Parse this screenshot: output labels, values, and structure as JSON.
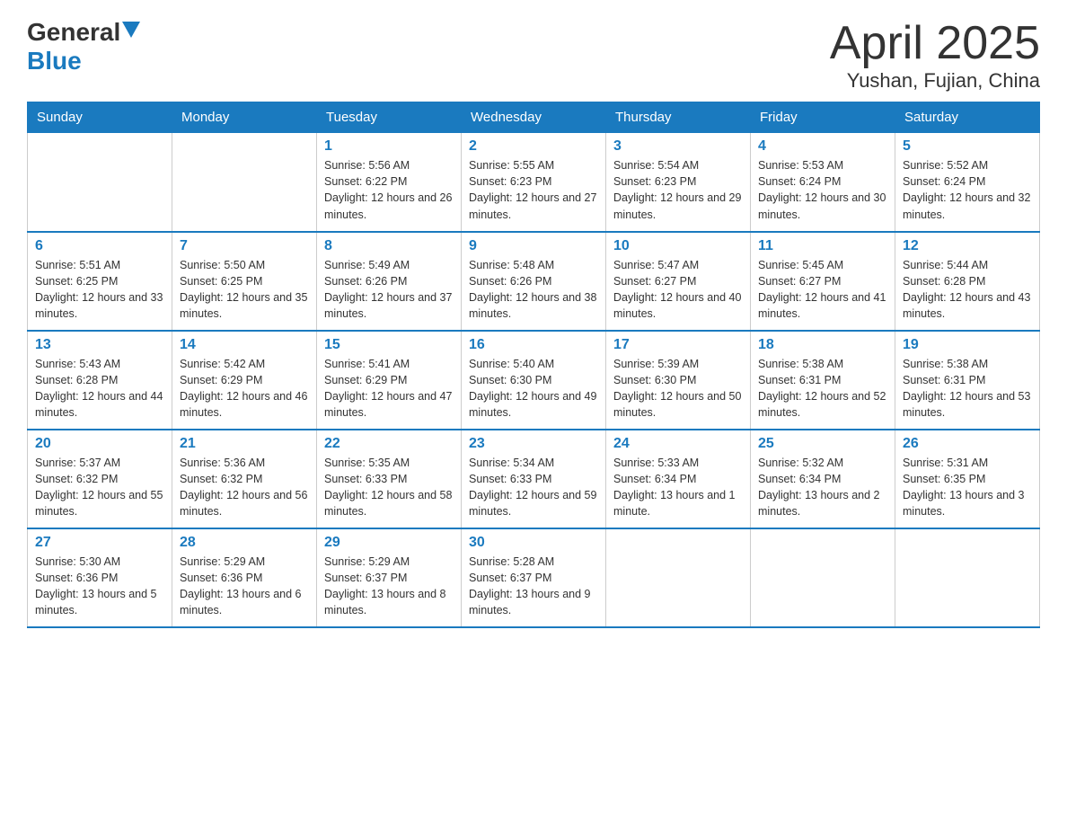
{
  "header": {
    "logo_general": "General",
    "logo_blue": "Blue",
    "month": "April 2025",
    "location": "Yushan, Fujian, China"
  },
  "weekdays": [
    "Sunday",
    "Monday",
    "Tuesday",
    "Wednesday",
    "Thursday",
    "Friday",
    "Saturday"
  ],
  "weeks": [
    [
      null,
      null,
      {
        "day": 1,
        "sunrise": "5:56 AM",
        "sunset": "6:22 PM",
        "daylight": "12 hours and 26 minutes."
      },
      {
        "day": 2,
        "sunrise": "5:55 AM",
        "sunset": "6:23 PM",
        "daylight": "12 hours and 27 minutes."
      },
      {
        "day": 3,
        "sunrise": "5:54 AM",
        "sunset": "6:23 PM",
        "daylight": "12 hours and 29 minutes."
      },
      {
        "day": 4,
        "sunrise": "5:53 AM",
        "sunset": "6:24 PM",
        "daylight": "12 hours and 30 minutes."
      },
      {
        "day": 5,
        "sunrise": "5:52 AM",
        "sunset": "6:24 PM",
        "daylight": "12 hours and 32 minutes."
      }
    ],
    [
      {
        "day": 6,
        "sunrise": "5:51 AM",
        "sunset": "6:25 PM",
        "daylight": "12 hours and 33 minutes."
      },
      {
        "day": 7,
        "sunrise": "5:50 AM",
        "sunset": "6:25 PM",
        "daylight": "12 hours and 35 minutes."
      },
      {
        "day": 8,
        "sunrise": "5:49 AM",
        "sunset": "6:26 PM",
        "daylight": "12 hours and 37 minutes."
      },
      {
        "day": 9,
        "sunrise": "5:48 AM",
        "sunset": "6:26 PM",
        "daylight": "12 hours and 38 minutes."
      },
      {
        "day": 10,
        "sunrise": "5:47 AM",
        "sunset": "6:27 PM",
        "daylight": "12 hours and 40 minutes."
      },
      {
        "day": 11,
        "sunrise": "5:45 AM",
        "sunset": "6:27 PM",
        "daylight": "12 hours and 41 minutes."
      },
      {
        "day": 12,
        "sunrise": "5:44 AM",
        "sunset": "6:28 PM",
        "daylight": "12 hours and 43 minutes."
      }
    ],
    [
      {
        "day": 13,
        "sunrise": "5:43 AM",
        "sunset": "6:28 PM",
        "daylight": "12 hours and 44 minutes."
      },
      {
        "day": 14,
        "sunrise": "5:42 AM",
        "sunset": "6:29 PM",
        "daylight": "12 hours and 46 minutes."
      },
      {
        "day": 15,
        "sunrise": "5:41 AM",
        "sunset": "6:29 PM",
        "daylight": "12 hours and 47 minutes."
      },
      {
        "day": 16,
        "sunrise": "5:40 AM",
        "sunset": "6:30 PM",
        "daylight": "12 hours and 49 minutes."
      },
      {
        "day": 17,
        "sunrise": "5:39 AM",
        "sunset": "6:30 PM",
        "daylight": "12 hours and 50 minutes."
      },
      {
        "day": 18,
        "sunrise": "5:38 AM",
        "sunset": "6:31 PM",
        "daylight": "12 hours and 52 minutes."
      },
      {
        "day": 19,
        "sunrise": "5:38 AM",
        "sunset": "6:31 PM",
        "daylight": "12 hours and 53 minutes."
      }
    ],
    [
      {
        "day": 20,
        "sunrise": "5:37 AM",
        "sunset": "6:32 PM",
        "daylight": "12 hours and 55 minutes."
      },
      {
        "day": 21,
        "sunrise": "5:36 AM",
        "sunset": "6:32 PM",
        "daylight": "12 hours and 56 minutes."
      },
      {
        "day": 22,
        "sunrise": "5:35 AM",
        "sunset": "6:33 PM",
        "daylight": "12 hours and 58 minutes."
      },
      {
        "day": 23,
        "sunrise": "5:34 AM",
        "sunset": "6:33 PM",
        "daylight": "12 hours and 59 minutes."
      },
      {
        "day": 24,
        "sunrise": "5:33 AM",
        "sunset": "6:34 PM",
        "daylight": "13 hours and 1 minute."
      },
      {
        "day": 25,
        "sunrise": "5:32 AM",
        "sunset": "6:34 PM",
        "daylight": "13 hours and 2 minutes."
      },
      {
        "day": 26,
        "sunrise": "5:31 AM",
        "sunset": "6:35 PM",
        "daylight": "13 hours and 3 minutes."
      }
    ],
    [
      {
        "day": 27,
        "sunrise": "5:30 AM",
        "sunset": "6:36 PM",
        "daylight": "13 hours and 5 minutes."
      },
      {
        "day": 28,
        "sunrise": "5:29 AM",
        "sunset": "6:36 PM",
        "daylight": "13 hours and 6 minutes."
      },
      {
        "day": 29,
        "sunrise": "5:29 AM",
        "sunset": "6:37 PM",
        "daylight": "13 hours and 8 minutes."
      },
      {
        "day": 30,
        "sunrise": "5:28 AM",
        "sunset": "6:37 PM",
        "daylight": "13 hours and 9 minutes."
      },
      null,
      null,
      null
    ]
  ]
}
